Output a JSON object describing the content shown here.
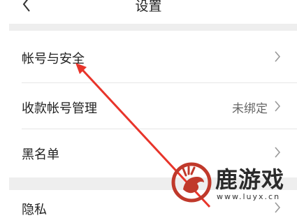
{
  "header": {
    "title": "设置",
    "back_icon": "chevron-left-icon"
  },
  "settings": {
    "items": [
      {
        "label": "帐号与安全",
        "value": ""
      },
      {
        "label": "收款帐号管理",
        "value": "未绑定"
      },
      {
        "label": "黑名单",
        "value": ""
      },
      {
        "label": "隐私",
        "value": ""
      }
    ]
  },
  "annotation": {
    "arrow_color": "#e8342a"
  },
  "watermark": {
    "title": "鹿游戏",
    "url": "www.luyx.cn",
    "logo_color": "#c0392b"
  }
}
